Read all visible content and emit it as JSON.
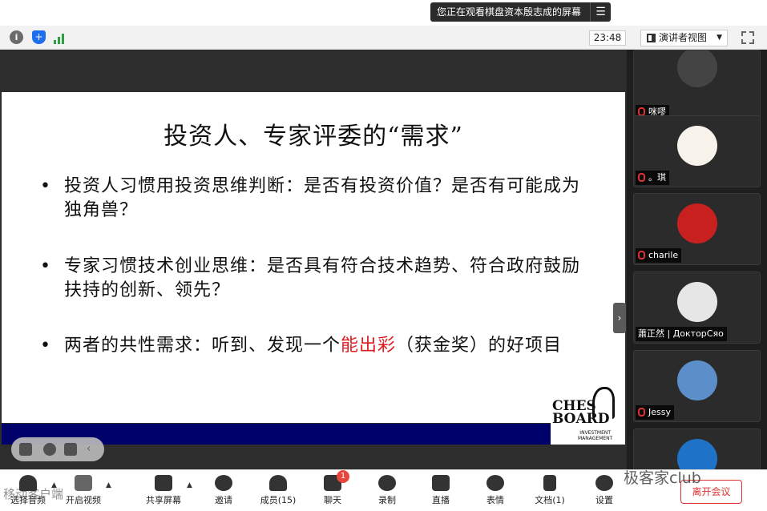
{
  "share_banner": {
    "text": "您正在观看棋盘资本殷志成的屏幕",
    "menu_icon": "menu-icon"
  },
  "toolbar": {
    "time": "23:48",
    "view_label": "演讲者视图"
  },
  "slide": {
    "title": "投资人、专家评委的“需求”",
    "bullets": [
      {
        "dot": "•",
        "text": "投资人习惯用投资思维判断：是否有投资价值？是否有可能成为独角兽？"
      },
      {
        "dot": "•",
        "text": "专家习惯技术创业思维：是否具有符合技术趋势、符合政府鼓励扶持的创新、领先？"
      },
      {
        "dot": "•",
        "pre": "两者的共性需求：听到、发现一个",
        "highlight": "能出彩",
        "post": "（获金奖）的好项目"
      }
    ],
    "logo_line1": "CHES",
    "logo_line2": "BOARD",
    "logo_sub1": "INVESTMENT",
    "logo_sub2": "MANAGEMENT"
  },
  "participants": [
    {
      "name": "咪嘐",
      "mic": "muted"
    },
    {
      "name": "。琪",
      "mic": "muted"
    },
    {
      "name": "charile",
      "mic": "muted"
    },
    {
      "name": "蕭正然 | ДокторСяо",
      "mic": "on"
    },
    {
      "name": "Jessy",
      "mic": "muted"
    }
  ],
  "bottombar": {
    "audio": "选择音频",
    "video": "开启视频",
    "share": "共享屏幕",
    "invite": "邀请",
    "members": "成员(15)",
    "chat": "聊天",
    "chat_badge": "1",
    "record": "录制",
    "live": "直播",
    "reactions": "表情",
    "docs": "文档(1)",
    "settings": "设置",
    "leave": "离开会议"
  },
  "watermark": "极客家club",
  "watermark_left": "移动客户端"
}
